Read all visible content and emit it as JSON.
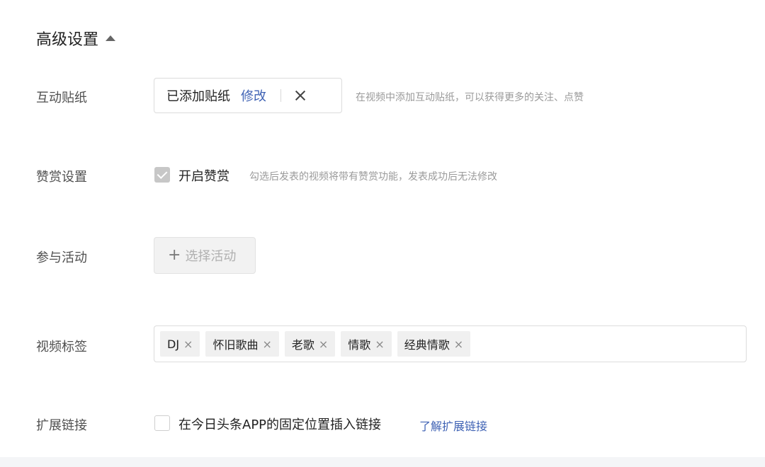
{
  "section": {
    "title": "高级设置"
  },
  "sticker": {
    "label": "互动贴纸",
    "value": "已添加贴纸",
    "modify": "修改",
    "hint": "在视频中添加互动贴纸，可以获得更多的关注、点赞"
  },
  "reward": {
    "label": "赞赏设置",
    "checked": true,
    "option": "开启赞赏",
    "hint": "勾选后发表的视频将带有赞赏功能，发表成功后无法修改"
  },
  "activity": {
    "label": "参与活动",
    "button": "选择活动"
  },
  "tags": {
    "label": "视频标签",
    "items": [
      {
        "text": "DJ",
        "remove": "×"
      },
      {
        "text": "怀旧歌曲",
        "remove": "×"
      },
      {
        "text": "老歌",
        "remove": "×"
      },
      {
        "text": "情歌",
        "remove": "×"
      },
      {
        "text": "经典情歌",
        "remove": "×"
      }
    ]
  },
  "extension": {
    "label": "扩展链接",
    "checked": false,
    "option": "在今日头条APP的固定位置插入链接",
    "link": "了解扩展链接"
  }
}
